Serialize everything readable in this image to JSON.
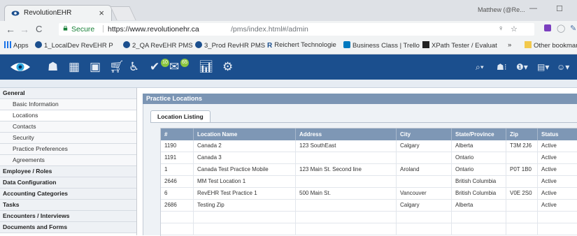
{
  "browser": {
    "tab_title": "RevolutionEHR",
    "tab_close": "×",
    "user": "Matthew (@Re...",
    "minimize": "—",
    "maximize": "☐",
    "secure": "Secure",
    "url_domain": "https://www.revolutionehr.ca",
    "url_path": "/pms/index.html#/admin",
    "bookmarks": [
      "Apps",
      "1_LocalDev RevEHR P",
      "2_QA RevEHR PMS",
      "3_Prod RevHR PMS",
      "Reichert Technologie",
      "Business Class | Trello",
      "XPath Tester / Evaluat",
      "»",
      "Other bookmar"
    ]
  },
  "toolbar": {
    "badge_1": "10",
    "badge_2": "65",
    "icons": [
      "eye-logo-icon",
      "people-icon",
      "calendar-icon",
      "id-card-icon",
      "cart-icon",
      "wheelchair-icon",
      "check-badge-icon",
      "check-badge-icon",
      "bar-chart-icon",
      "gear-icon"
    ],
    "right_icons": [
      "search-icon",
      "people-icon",
      "help-icon",
      "inbox-icon",
      "user-icon"
    ]
  },
  "sidebar": {
    "items": [
      {
        "label": "General",
        "type": "section"
      },
      {
        "label": "Basic Information",
        "type": "sub"
      },
      {
        "label": "Locations",
        "type": "sub",
        "active": true
      },
      {
        "label": "Contacts",
        "type": "sub"
      },
      {
        "label": "Security",
        "type": "sub"
      },
      {
        "label": "Practice Preferences",
        "type": "sub"
      },
      {
        "label": "Agreements",
        "type": "sub"
      },
      {
        "label": "Employee / Roles",
        "type": "section"
      },
      {
        "label": "Data Configuration",
        "type": "section"
      },
      {
        "label": "Accounting Categories",
        "type": "section"
      },
      {
        "label": "Tasks",
        "type": "section"
      },
      {
        "label": "Encounters / Interviews",
        "type": "section"
      },
      {
        "label": "Documents and Forms",
        "type": "section"
      }
    ]
  },
  "main": {
    "panel_title": "Practice Locations",
    "tab_label": "Location Listing",
    "columns": [
      "#",
      "Location Name",
      "Address",
      "City",
      "State/Province",
      "Zip",
      "Status"
    ],
    "rows": [
      [
        "1190",
        "Canada 2",
        "123 SouthEast",
        "Calgary",
        "Alberta",
        "T3M 2J6",
        "Active"
      ],
      [
        "1191",
        "Canada 3",
        "",
        "",
        "Ontario",
        "",
        "Active"
      ],
      [
        "1",
        "Canada Test Practice Mobile",
        "123 Main St.  Second line",
        "Aroland",
        "Ontario",
        "P0T 1B0",
        "Active"
      ],
      [
        "2646",
        "MM Test Location 1",
        "",
        "",
        "British Columbia",
        "",
        "Active"
      ],
      [
        "6",
        "RevEHR Test Practice 1",
        "500 Main St.",
        "Vancouver",
        "British Columbia",
        "V0E 2S0",
        "Active"
      ],
      [
        "2686",
        "Testing Zip",
        "",
        "Calgary",
        "Alberta",
        "",
        "Active"
      ],
      [
        "",
        "",
        "",
        "",
        "",
        "",
        ""
      ],
      [
        "",
        "",
        "",
        "",
        "",
        "",
        ""
      ]
    ]
  },
  "colors": {
    "toolbar": "#1b4f8e",
    "grid_header": "#7e97b5",
    "panel_header": "#7b95b4",
    "secure_green": "#188038"
  }
}
